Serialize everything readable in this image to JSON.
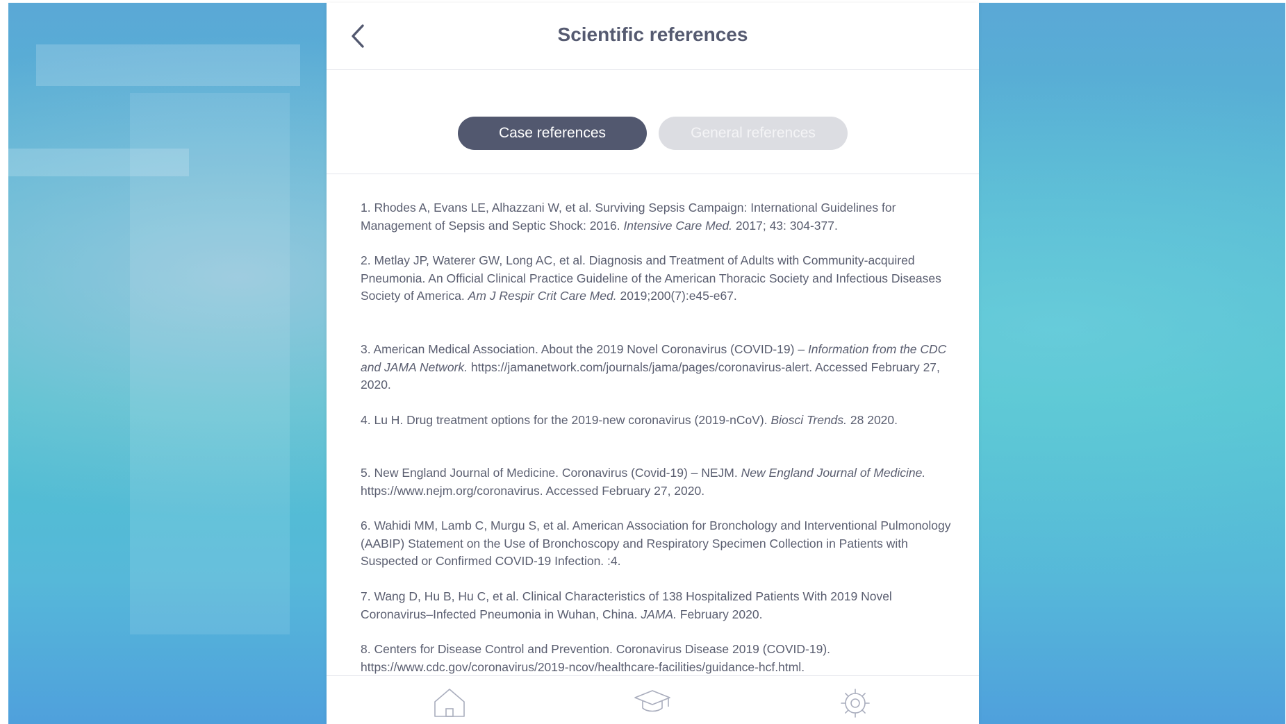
{
  "header": {
    "title": "Scientific references",
    "back_icon": "chevron-left-icon"
  },
  "tabs": [
    {
      "label": "Case references",
      "active": true
    },
    {
      "label": "General references",
      "active": false
    }
  ],
  "references": [
    {
      "before": "1. Rhodes A, Evans LE, Alhazzani W, et al. Surviving Sepsis Campaign: International Guidelines for Management of Sepsis and Septic Shock: 2016. ",
      "italic": "Intensive Care Med.",
      "after": " 2017; 43: 304-377."
    },
    {
      "before": "2. Metlay JP, Waterer GW, Long AC, et al. Diagnosis and Treatment of Adults with Community-acquired Pneumonia. An Official Clinical Practice Guideline of the American Thoracic Society and Infectious Diseases Society of America. ",
      "italic": "Am J Respir Crit Care Med.",
      "after": " 2019;200(7):e45-e67."
    },
    {
      "before": "3. American Medical Association. About the 2019 Novel Coronavirus (COVID-19) – ",
      "italic": "Information from the CDC and JAMA Network.",
      "after": " https://jamanetwork.com/journals/jama/pages/coronavirus-alert. Accessed February 27, 2020."
    },
    {
      "before": "4. Lu H. Drug treatment options for the 2019-new coronavirus (2019-nCoV). ",
      "italic": "Biosci Trends.",
      "after": " 28 2020."
    },
    {
      "before": "5. New England Journal of Medicine. Coronavirus (Covid-19) – NEJM. ",
      "italic": "New England Journal of Medicine.",
      "after": " https://www.nejm.org/coronavirus. Accessed February 27, 2020."
    },
    {
      "before": "6. Wahidi MM, Lamb C, Murgu S, et al. American Association for Bronchology and Interventional Pulmonology (AABIP) Statement on the Use of Bronchoscopy and Respiratory Specimen Collection in Patients with Suspected or Confirmed COVID-19 Infection. :4.",
      "italic": "",
      "after": ""
    },
    {
      "before": "7. Wang D, Hu B, Hu C, et al. Clinical Characteristics of 138 Hospitalized Patients With 2019 Novel Coronavirus–Infected Pneumonia in Wuhan, China. ",
      "italic": "JAMA.",
      "after": " February 2020."
    },
    {
      "before": "8. Centers for Disease Control and Prevention. Coronavirus Disease 2019 (COVID-19). https://www.cdc.gov/coronavirus/2019-ncov/healthcare-facilities/guidance-hcf.html.",
      "italic": "",
      "after": ""
    }
  ],
  "bottom_nav": [
    {
      "icon": "home-icon"
    },
    {
      "icon": "graduation-cap-icon"
    },
    {
      "icon": "gear-icon"
    }
  ],
  "colors": {
    "accent": "#52586f",
    "inactive_tab": "#dcdde2",
    "text": "#5a5e70",
    "background_blue": "#4fc1cf"
  }
}
